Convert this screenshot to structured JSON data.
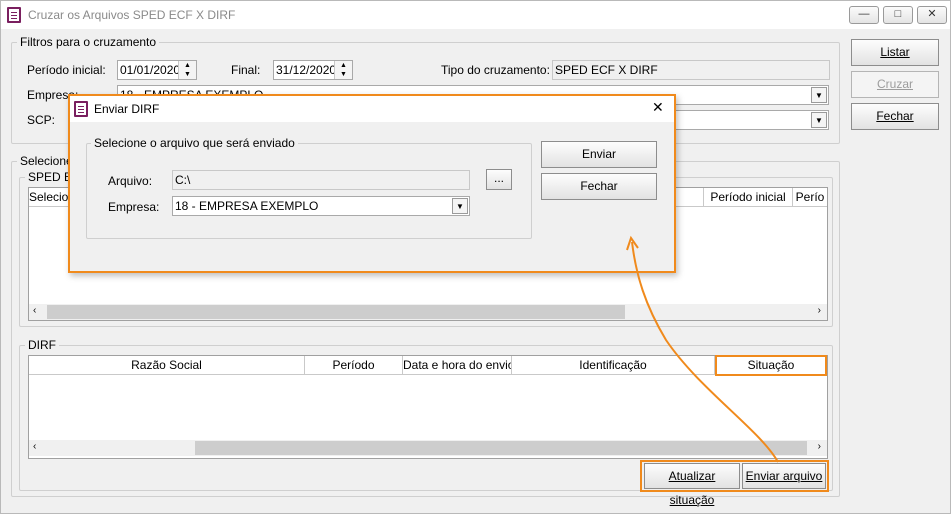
{
  "window": {
    "title": "Cruzar os Arquivos SPED ECF X DIRF",
    "controls": [
      "—",
      "□",
      "✕"
    ]
  },
  "filters": {
    "legend": "Filtros para o cruzamento",
    "periodo_inicial_label": "Período inicial:",
    "periodo_inicial": "01/01/2020",
    "final_label": "Final:",
    "final": "31/12/2020",
    "tipo_label": "Tipo do cruzamento:",
    "tipo": "SPED ECF X DIRF",
    "empresa_label": "Empresa:",
    "empresa": "18 - EMPRESA EXEMPLO",
    "scp_label": "SCP:",
    "scp": ""
  },
  "side_buttons": {
    "listar": "Listar",
    "cruzar": "Cruzar",
    "fechar": "Fechar"
  },
  "select_group": {
    "legend": "Selecione",
    "sped_legend": "SPED E",
    "sped_columns": [
      "Selecio",
      "Período inicial",
      "Perío"
    ]
  },
  "dirf": {
    "legend": "DIRF",
    "columns": [
      "Razão Social",
      "Período",
      "Data e hora do envio",
      "Identificação",
      "Situação"
    ],
    "atualizar": "Atualizar situação",
    "enviar": "Enviar arquivo"
  },
  "dialog": {
    "title": "Enviar DIRF",
    "close": "✕",
    "group_legend": "Selecione o arquivo que será enviado",
    "arquivo_label": "Arquivo:",
    "arquivo": "C:\\",
    "browse": "...",
    "empresa_label": "Empresa:",
    "empresa": "18 - EMPRESA EXEMPLO",
    "enviar": "Enviar",
    "fechar": "Fechar"
  },
  "colors": {
    "accent": "#f08a1c",
    "app_icon": "#7a1f5f"
  }
}
